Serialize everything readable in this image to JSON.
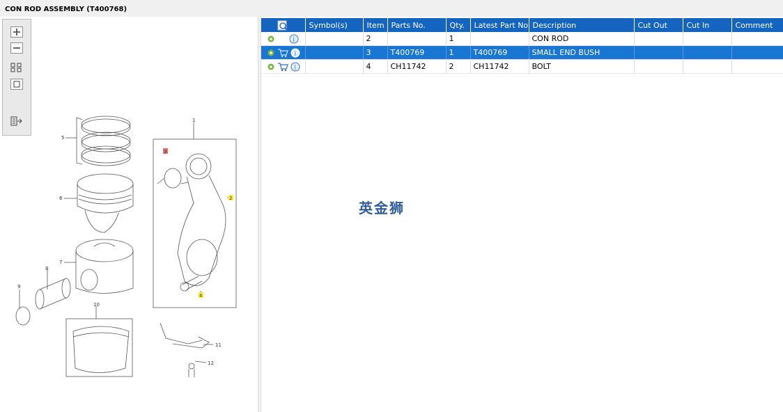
{
  "window": {
    "title": "CON ROD ASSEMBLY (T400768)"
  },
  "toolbar": {
    "zoom_in": "zoom-in-icon",
    "zoom_out": "zoom-out-icon",
    "fit": "fit-icon",
    "actual": "actual-size-icon",
    "export": "export-icon"
  },
  "diagram": {
    "callouts": [
      "1",
      "2",
      "3",
      "4",
      "5",
      "6",
      "7",
      "8",
      "9",
      "10",
      "11",
      "12"
    ]
  },
  "table": {
    "headers": [
      "",
      "Symbol(s)",
      "Item",
      "Parts No.",
      "Qty.",
      "Latest Part No.",
      "Description",
      "Cut Out",
      "Cut In",
      "Comment"
    ],
    "rows": [
      {
        "item": "2",
        "parts_no": "",
        "qty": "1",
        "latest": "",
        "description": "CON ROD",
        "cut_out": "",
        "cut_in": "",
        "comment": "",
        "cart": false,
        "selected": false
      },
      {
        "item": "3",
        "parts_no": "T400769",
        "qty": "1",
        "latest": "T400769",
        "description": "SMALL END BUSH",
        "cut_out": "",
        "cut_in": "",
        "comment": "",
        "cart": true,
        "selected": true
      },
      {
        "item": "4",
        "parts_no": "CH11742",
        "qty": "2",
        "latest": "CH11742",
        "description": "BOLT",
        "cut_out": "",
        "cut_in": "",
        "comment": "",
        "cart": true,
        "selected": false
      }
    ]
  },
  "watermark": "英金狮",
  "colors": {
    "header": "#1565c0",
    "selected": "#1976d2",
    "highlight_red": "#e57373",
    "highlight_yellow": "#ffeb3b"
  }
}
